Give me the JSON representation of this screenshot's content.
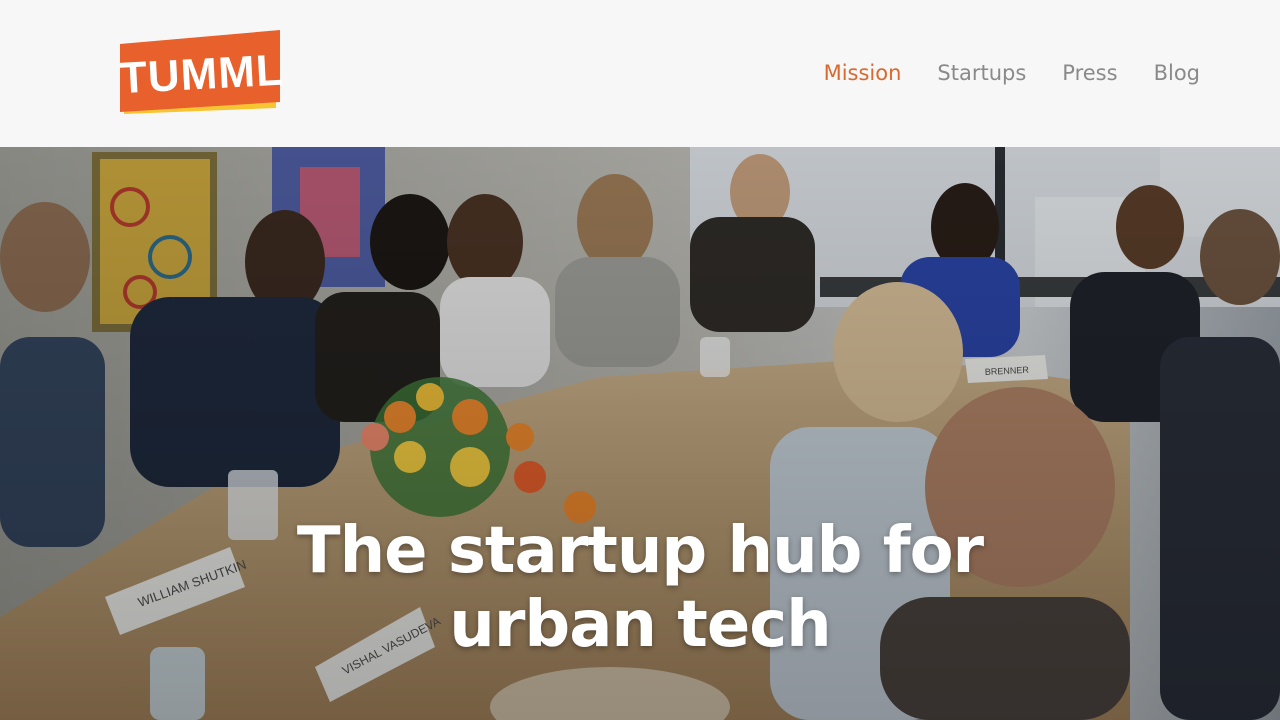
{
  "brand": {
    "logo_text": "TUMML",
    "accent_color": "#e8602c",
    "accent_stripe_color": "#f7c531"
  },
  "nav": {
    "items": [
      {
        "label": "Mission",
        "active": true
      },
      {
        "label": "Startups",
        "active": false
      },
      {
        "label": "Press",
        "active": false
      },
      {
        "label": "Blog",
        "active": false
      }
    ],
    "active_color": "#d9692e",
    "inactive_color": "#8a8a8a"
  },
  "hero": {
    "title_line_1": "The startup hub for",
    "title_line_2": "urban tech",
    "name_cards": [
      "WILLIAM SHUTKIN",
      "VISHAL VASUDEVA",
      "BRENNER"
    ]
  }
}
